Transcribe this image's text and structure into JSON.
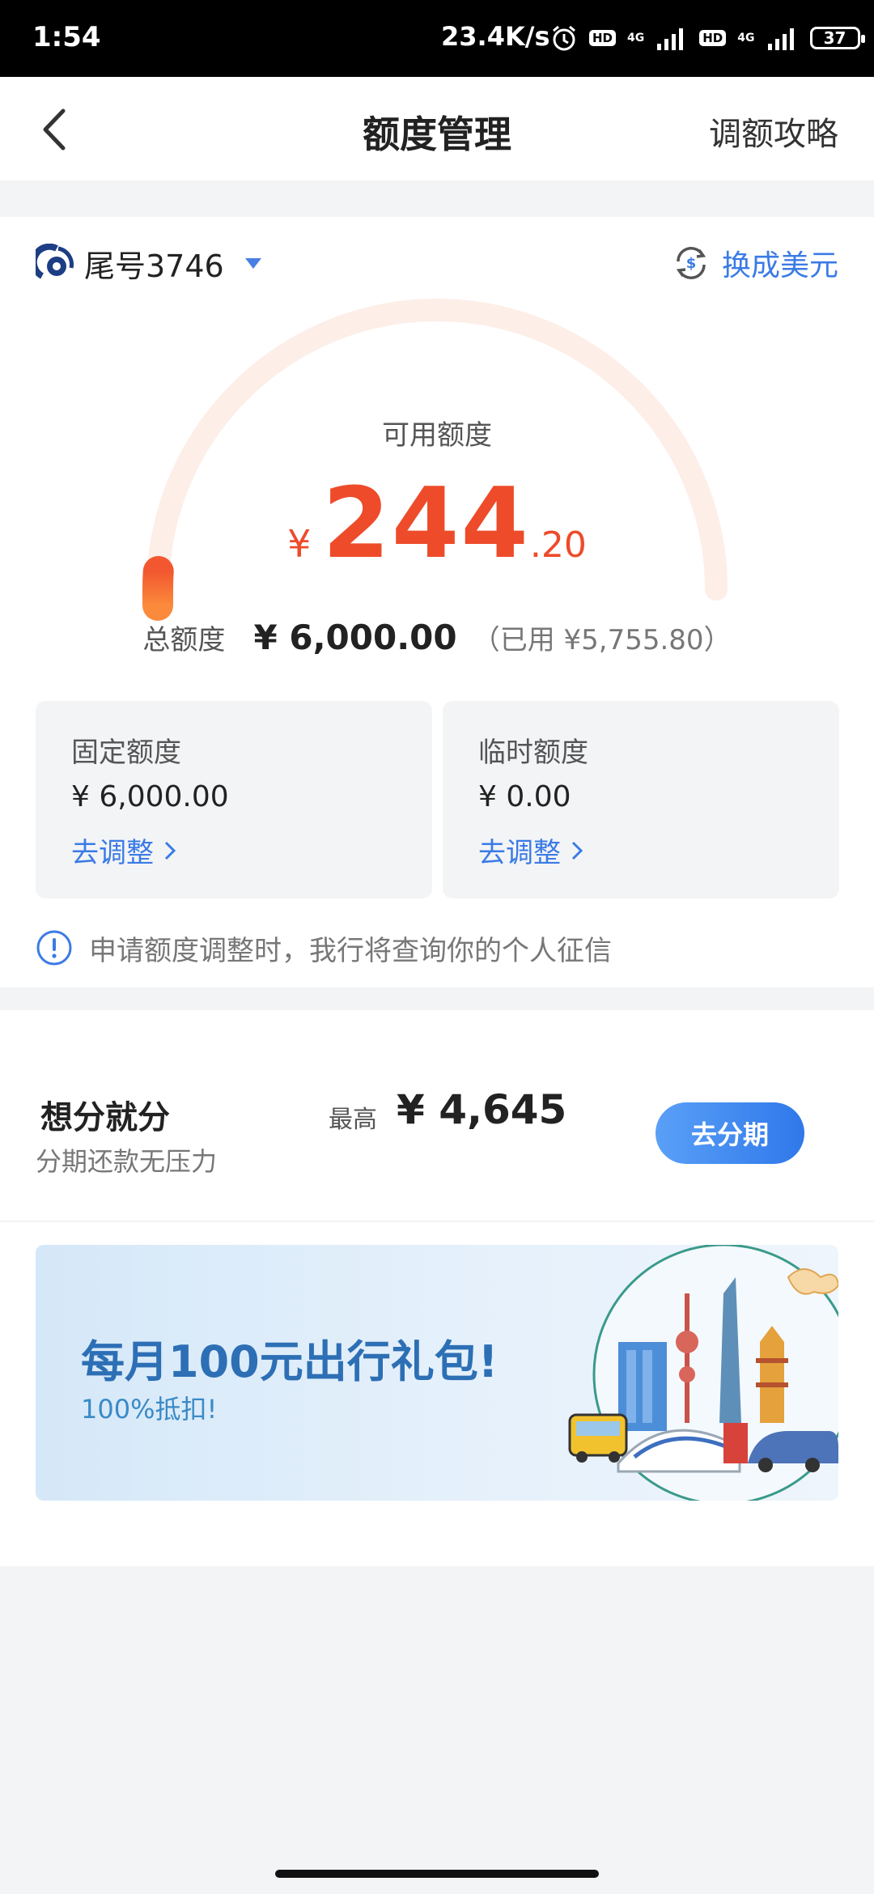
{
  "status_bar": {
    "time": "1:54",
    "net_speed": "23.4K/s",
    "hd_label": "HD",
    "network_label": "4G",
    "battery": "37"
  },
  "nav": {
    "title": "额度管理",
    "guide_link": "调额攻略"
  },
  "card": {
    "card_label": "尾号3746",
    "convert_label": "换成美元",
    "available_label": "可用额度",
    "currency_symbol": "¥",
    "available_integer": "244",
    "available_decimal": ".20",
    "available_fraction_of_total": 0.0407,
    "total_label": "总额度",
    "total_value": "¥ 6,000.00",
    "used_text": "（已用 ¥5,755.80）",
    "fixed": {
      "title": "固定额度",
      "value": "¥ 6,000.00",
      "link": "去调整"
    },
    "temporary": {
      "title": "临时额度",
      "value": "¥ 0.00",
      "link": "去调整"
    },
    "notice": "申请额度调整时，我行将查询你的个人征信"
  },
  "installment": {
    "title": "想分就分",
    "subtitle": "分期还款无压力",
    "max_label": "最高",
    "max_value": "¥ 4,645",
    "button": "去分期"
  },
  "banner": {
    "title": "每月100元出行礼包!",
    "subtitle": "100%抵扣!"
  },
  "colors": {
    "accent_blue": "#3b7be5",
    "amount_red": "#ee4b2b",
    "gauge_track": "#fdeee8"
  }
}
